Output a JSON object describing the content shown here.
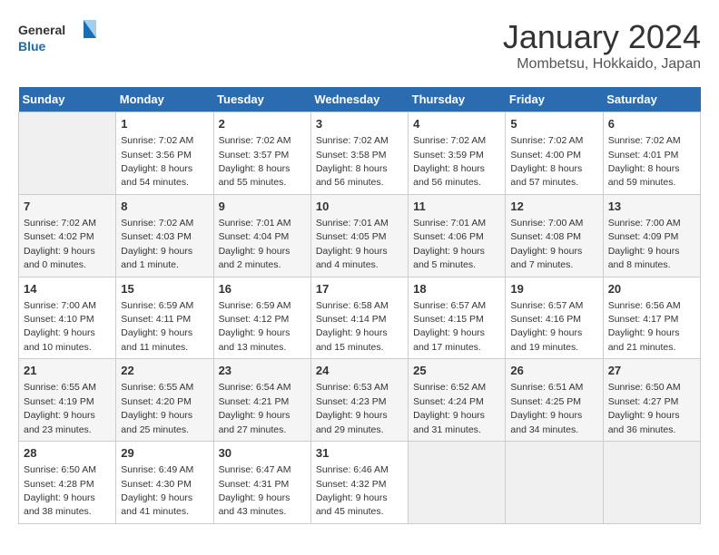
{
  "header": {
    "logo_line1": "General",
    "logo_line2": "Blue",
    "title": "January 2024",
    "subtitle": "Mombetsu, Hokkaido, Japan"
  },
  "weekdays": [
    "Sunday",
    "Monday",
    "Tuesday",
    "Wednesday",
    "Thursday",
    "Friday",
    "Saturday"
  ],
  "weeks": [
    [
      {
        "day": "",
        "empty": true
      },
      {
        "day": "1",
        "sunrise": "7:02 AM",
        "sunset": "3:56 PM",
        "daylight": "8 hours and 54 minutes."
      },
      {
        "day": "2",
        "sunrise": "7:02 AM",
        "sunset": "3:57 PM",
        "daylight": "8 hours and 55 minutes."
      },
      {
        "day": "3",
        "sunrise": "7:02 AM",
        "sunset": "3:58 PM",
        "daylight": "8 hours and 56 minutes."
      },
      {
        "day": "4",
        "sunrise": "7:02 AM",
        "sunset": "3:59 PM",
        "daylight": "8 hours and 56 minutes."
      },
      {
        "day": "5",
        "sunrise": "7:02 AM",
        "sunset": "4:00 PM",
        "daylight": "8 hours and 57 minutes."
      },
      {
        "day": "6",
        "sunrise": "7:02 AM",
        "sunset": "4:01 PM",
        "daylight": "8 hours and 59 minutes."
      }
    ],
    [
      {
        "day": "7",
        "sunrise": "7:02 AM",
        "sunset": "4:02 PM",
        "daylight": "9 hours and 0 minutes."
      },
      {
        "day": "8",
        "sunrise": "7:02 AM",
        "sunset": "4:03 PM",
        "daylight": "9 hours and 1 minute."
      },
      {
        "day": "9",
        "sunrise": "7:01 AM",
        "sunset": "4:04 PM",
        "daylight": "9 hours and 2 minutes."
      },
      {
        "day": "10",
        "sunrise": "7:01 AM",
        "sunset": "4:05 PM",
        "daylight": "9 hours and 4 minutes."
      },
      {
        "day": "11",
        "sunrise": "7:01 AM",
        "sunset": "4:06 PM",
        "daylight": "9 hours and 5 minutes."
      },
      {
        "day": "12",
        "sunrise": "7:00 AM",
        "sunset": "4:08 PM",
        "daylight": "9 hours and 7 minutes."
      },
      {
        "day": "13",
        "sunrise": "7:00 AM",
        "sunset": "4:09 PM",
        "daylight": "9 hours and 8 minutes."
      }
    ],
    [
      {
        "day": "14",
        "sunrise": "7:00 AM",
        "sunset": "4:10 PM",
        "daylight": "9 hours and 10 minutes."
      },
      {
        "day": "15",
        "sunrise": "6:59 AM",
        "sunset": "4:11 PM",
        "daylight": "9 hours and 11 minutes."
      },
      {
        "day": "16",
        "sunrise": "6:59 AM",
        "sunset": "4:12 PM",
        "daylight": "9 hours and 13 minutes."
      },
      {
        "day": "17",
        "sunrise": "6:58 AM",
        "sunset": "4:14 PM",
        "daylight": "9 hours and 15 minutes."
      },
      {
        "day": "18",
        "sunrise": "6:57 AM",
        "sunset": "4:15 PM",
        "daylight": "9 hours and 17 minutes."
      },
      {
        "day": "19",
        "sunrise": "6:57 AM",
        "sunset": "4:16 PM",
        "daylight": "9 hours and 19 minutes."
      },
      {
        "day": "20",
        "sunrise": "6:56 AM",
        "sunset": "4:17 PM",
        "daylight": "9 hours and 21 minutes."
      }
    ],
    [
      {
        "day": "21",
        "sunrise": "6:55 AM",
        "sunset": "4:19 PM",
        "daylight": "9 hours and 23 minutes."
      },
      {
        "day": "22",
        "sunrise": "6:55 AM",
        "sunset": "4:20 PM",
        "daylight": "9 hours and 25 minutes."
      },
      {
        "day": "23",
        "sunrise": "6:54 AM",
        "sunset": "4:21 PM",
        "daylight": "9 hours and 27 minutes."
      },
      {
        "day": "24",
        "sunrise": "6:53 AM",
        "sunset": "4:23 PM",
        "daylight": "9 hours and 29 minutes."
      },
      {
        "day": "25",
        "sunrise": "6:52 AM",
        "sunset": "4:24 PM",
        "daylight": "9 hours and 31 minutes."
      },
      {
        "day": "26",
        "sunrise": "6:51 AM",
        "sunset": "4:25 PM",
        "daylight": "9 hours and 34 minutes."
      },
      {
        "day": "27",
        "sunrise": "6:50 AM",
        "sunset": "4:27 PM",
        "daylight": "9 hours and 36 minutes."
      }
    ],
    [
      {
        "day": "28",
        "sunrise": "6:50 AM",
        "sunset": "4:28 PM",
        "daylight": "9 hours and 38 minutes."
      },
      {
        "day": "29",
        "sunrise": "6:49 AM",
        "sunset": "4:30 PM",
        "daylight": "9 hours and 41 minutes."
      },
      {
        "day": "30",
        "sunrise": "6:47 AM",
        "sunset": "4:31 PM",
        "daylight": "9 hours and 43 minutes."
      },
      {
        "day": "31",
        "sunrise": "6:46 AM",
        "sunset": "4:32 PM",
        "daylight": "9 hours and 45 minutes."
      },
      {
        "day": "",
        "empty": true
      },
      {
        "day": "",
        "empty": true
      },
      {
        "day": "",
        "empty": true
      }
    ]
  ]
}
